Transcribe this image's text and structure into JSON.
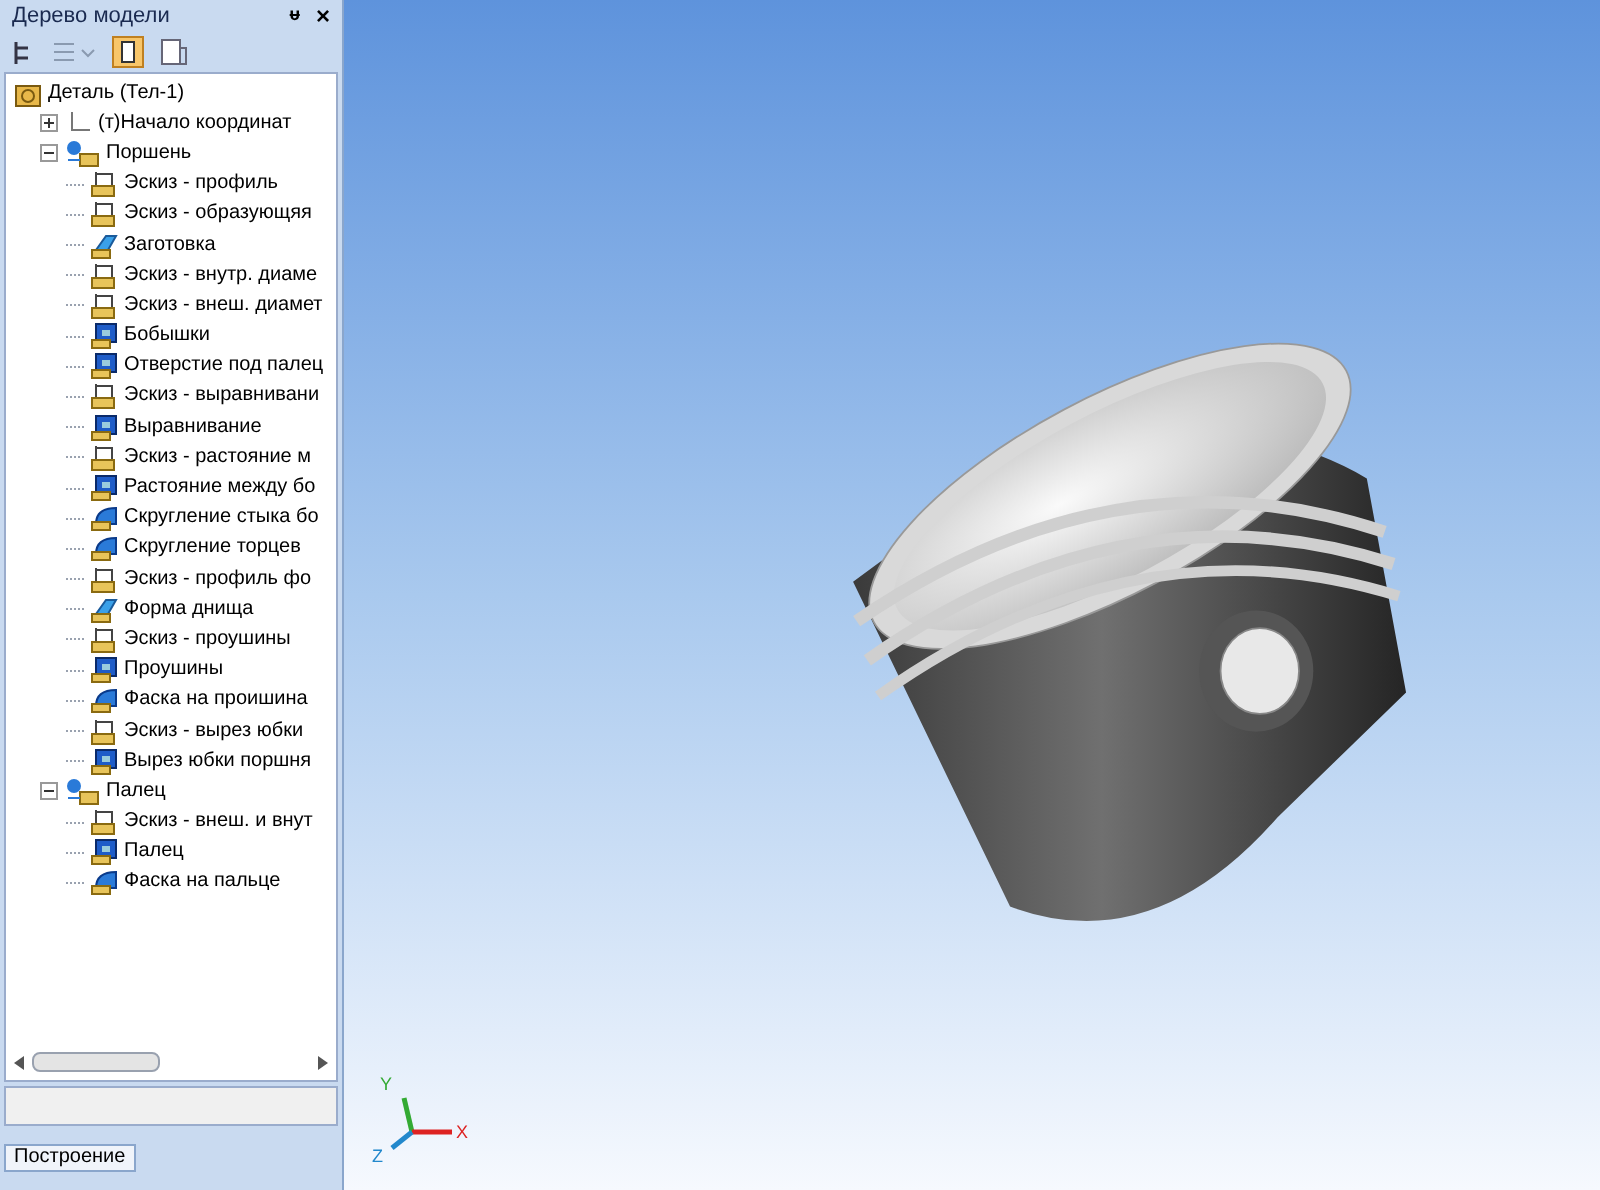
{
  "panel": {
    "title": "Дерево модели",
    "pin": "ᵾ",
    "close": "×"
  },
  "tree": [
    {
      "label": "Деталь (Тел-1)",
      "kind": "detail",
      "children": [
        {
          "label": "(т)Начало координат",
          "kind": "origin",
          "expanded": false
        },
        {
          "label": "Поршень",
          "kind": "part",
          "expanded": true,
          "children": [
            {
              "label": "Эскиз - профиль",
              "kind": "sketch"
            },
            {
              "label": "Эскиз - образующяя",
              "kind": "sketch"
            },
            {
              "label": "Заготовка",
              "kind": "extrude"
            },
            {
              "label": "Эскиз - внутр. диаме",
              "kind": "sketch"
            },
            {
              "label": "Эскиз - внеш. диамет",
              "kind": "sketch"
            },
            {
              "label": "Бобышки",
              "kind": "operation"
            },
            {
              "label": "Отверстие под палец",
              "kind": "operation"
            },
            {
              "label": "Эскиз - выравнивани",
              "kind": "sketch"
            },
            {
              "label": "Выравнивание",
              "kind": "operation"
            },
            {
              "label": "Эскиз - растояние м",
              "kind": "sketch"
            },
            {
              "label": "Растояние между бо",
              "kind": "operation"
            },
            {
              "label": "Скругление стыка бо",
              "kind": "fillet"
            },
            {
              "label": "Скругление торцев",
              "kind": "fillet"
            },
            {
              "label": "Эскиз - профиль фо",
              "kind": "sketch"
            },
            {
              "label": "Форма днища",
              "kind": "extrude"
            },
            {
              "label": "Эскиз - проушины",
              "kind": "sketch"
            },
            {
              "label": "Проушины",
              "kind": "operation"
            },
            {
              "label": "Фаска на проишина",
              "kind": "fillet"
            },
            {
              "label": "Эскиз - вырез юбки",
              "kind": "sketch"
            },
            {
              "label": "Вырез юбки поршня",
              "kind": "operation"
            }
          ]
        },
        {
          "label": "Палец",
          "kind": "part",
          "expanded": true,
          "children": [
            {
              "label": "Эскиз - внеш. и внут",
              "kind": "sketch"
            },
            {
              "label": "Палец",
              "kind": "operation"
            },
            {
              "label": "Фаска на пальце",
              "kind": "fillet"
            }
          ]
        }
      ]
    }
  ],
  "bottom_tab": "Построение",
  "axes": {
    "x": "X",
    "y": "Y",
    "z": "Z"
  }
}
